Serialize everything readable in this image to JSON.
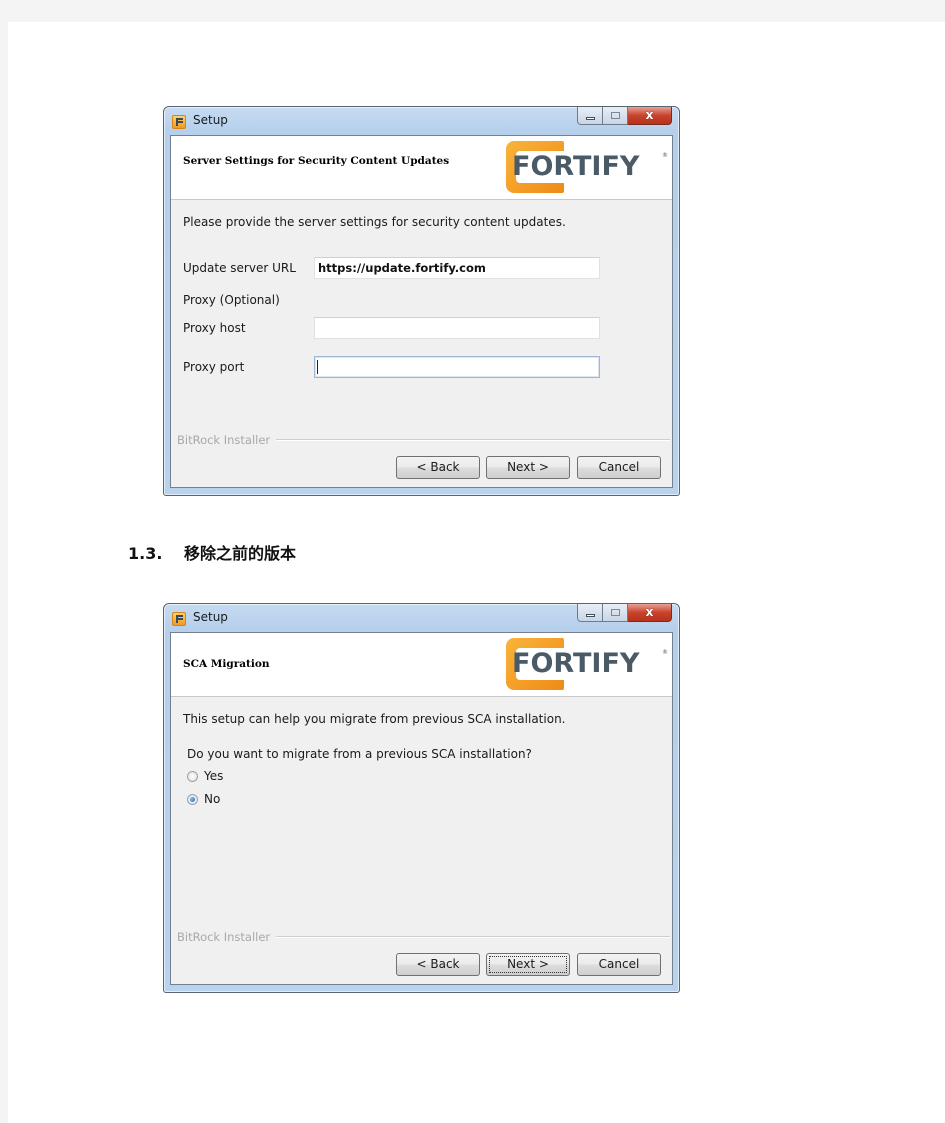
{
  "document": {
    "section_heading": {
      "number": "1.3.",
      "title": "移除之前的版本"
    }
  },
  "window1": {
    "title": "Setup",
    "header_title": "Server Settings for Security Content Updates",
    "logo_text": "FORTIFY",
    "logo_reg": "®",
    "intro": "Please provide the server settings for security content updates.",
    "fields": {
      "update_url_label": "Update server URL",
      "update_url_value": "https://update.fortify.com",
      "proxy_section_label": "Proxy (Optional)",
      "proxy_host_label": "Proxy host",
      "proxy_host_value": "",
      "proxy_port_label": "Proxy port",
      "proxy_port_value": ""
    },
    "footer_label": "BitRock Installer",
    "buttons": {
      "back": "< Back",
      "next": "Next >",
      "cancel": "Cancel"
    },
    "close_glyph": "x"
  },
  "window2": {
    "title": "Setup",
    "header_title": "SCA Migration",
    "logo_text": "FORTIFY",
    "logo_reg": "®",
    "intro": "This setup can help you migrate from previous SCA installation.",
    "question": "Do you want to migrate from a previous SCA installation?",
    "options": [
      {
        "label": "Yes",
        "selected": false
      },
      {
        "label": "No",
        "selected": true
      }
    ],
    "footer_label": "BitRock Installer",
    "buttons": {
      "back": "< Back",
      "next": "Next >",
      "cancel": "Cancel"
    },
    "close_glyph": "x"
  },
  "colors": {
    "logo_orange": "#f29a1c",
    "logo_gray": "#4a5a67",
    "window_frame": "#b9d2ee",
    "close_red": "#c7432c",
    "radio_selected": "#1f5ea8"
  }
}
